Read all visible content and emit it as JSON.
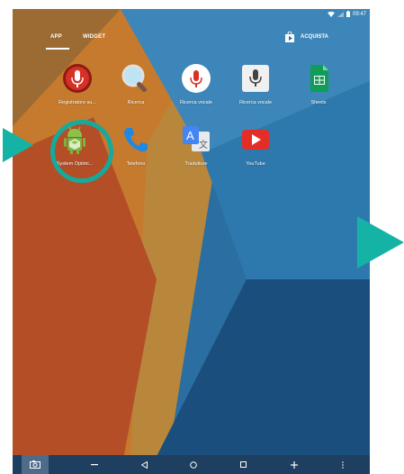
{
  "status": {
    "time": "09:47"
  },
  "tabs": {
    "app": "APP",
    "widget": "WIDGET",
    "acquista": "ACQUISTA"
  },
  "apps": [
    {
      "label": "Registratore su..."
    },
    {
      "label": "Ricerca"
    },
    {
      "label": "Ricerca vocale"
    },
    {
      "label": "Ricerca vocale"
    },
    {
      "label": "Sheets"
    },
    {
      "label": "System Optimi..."
    },
    {
      "label": "Telefono"
    },
    {
      "label": "Traduttore"
    },
    {
      "label": "YouTube"
    }
  ],
  "navbar": {
    "icons": [
      "screenshot-icon",
      "minus-icon",
      "back-icon",
      "home-icon",
      "recents-icon",
      "plus-icon",
      "more-icon"
    ]
  },
  "colors": {
    "highlight": "#16aa9d",
    "arrow": "#14b3a6",
    "navbar": "#1f3f60"
  }
}
